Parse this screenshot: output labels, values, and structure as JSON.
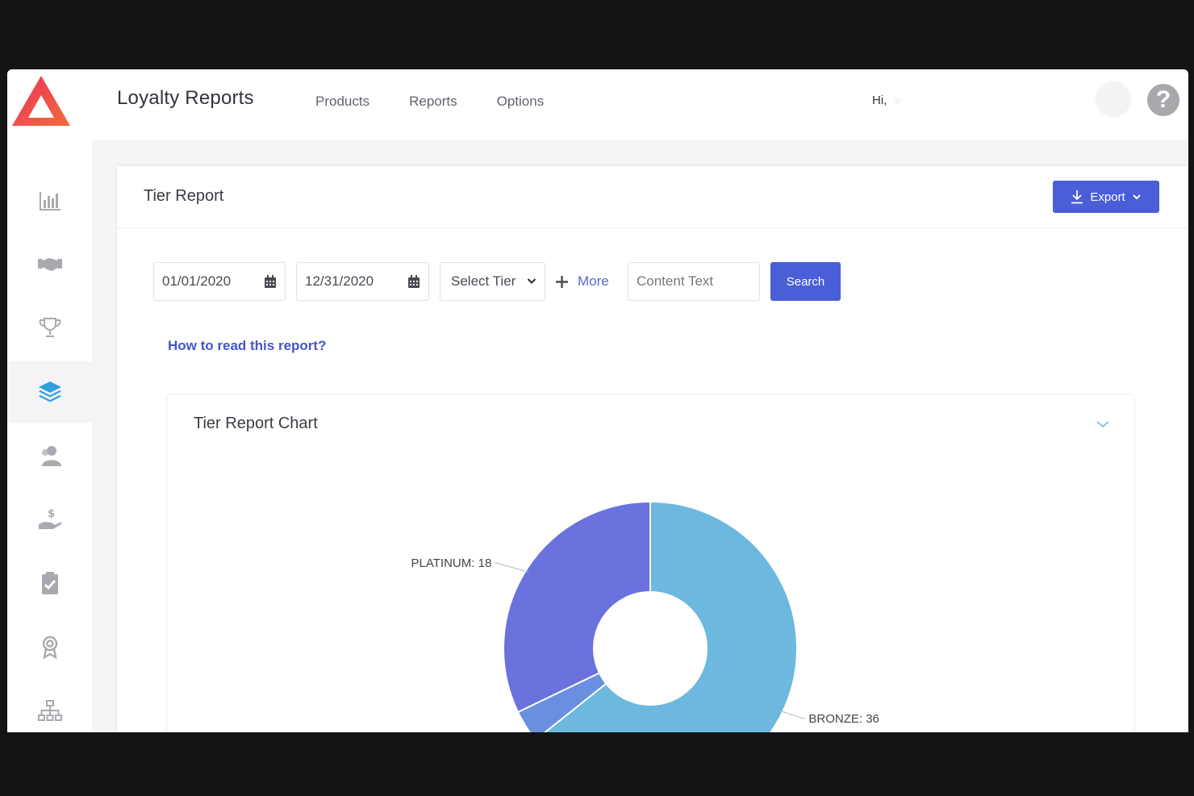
{
  "app": {
    "title": "Loyalty Reports",
    "nav": [
      "Products",
      "Reports",
      "Options"
    ],
    "greeting": "Hi,",
    "user_name": "v",
    "help_icon": "?"
  },
  "sidebar": {
    "items": [
      {
        "icon": "bar-chart-icon"
      },
      {
        "icon": "handshake-icon"
      },
      {
        "icon": "trophy-icon"
      },
      {
        "icon": "layers-icon",
        "active": true
      },
      {
        "icon": "users-icon"
      },
      {
        "icon": "hand-dollar-icon"
      },
      {
        "icon": "clipboard-check-icon"
      },
      {
        "icon": "award-icon"
      },
      {
        "icon": "sitemap-icon"
      }
    ]
  },
  "report": {
    "title": "Tier Report",
    "export_label": "Export",
    "filters": {
      "start_date": "01/01/2020",
      "end_date": "12/31/2020",
      "tier_select": "Select Tier",
      "more_label": "More",
      "content_placeholder": "Content Text",
      "search_label": "Search"
    },
    "help_link": "How to read this report?",
    "chart_title": "Tier Report Chart"
  },
  "colors": {
    "accent": "#4a5ed8",
    "bronze": "#6cb8de",
    "platinum": "#6a72de",
    "silver": "#6a8fe0"
  },
  "chart_data": {
    "type": "pie",
    "title": "Tier Report Chart",
    "donut": true,
    "slices": [
      {
        "label": "BRONZE",
        "value": 36,
        "color": "#6cb8de"
      },
      {
        "label": "",
        "value": 2,
        "color": "#6a8fe0"
      },
      {
        "label": "PLATINUM",
        "value": 18,
        "color": "#6a72de"
      }
    ],
    "data_labels": [
      "BRONZE: 36",
      "PLATINUM: 18"
    ]
  }
}
